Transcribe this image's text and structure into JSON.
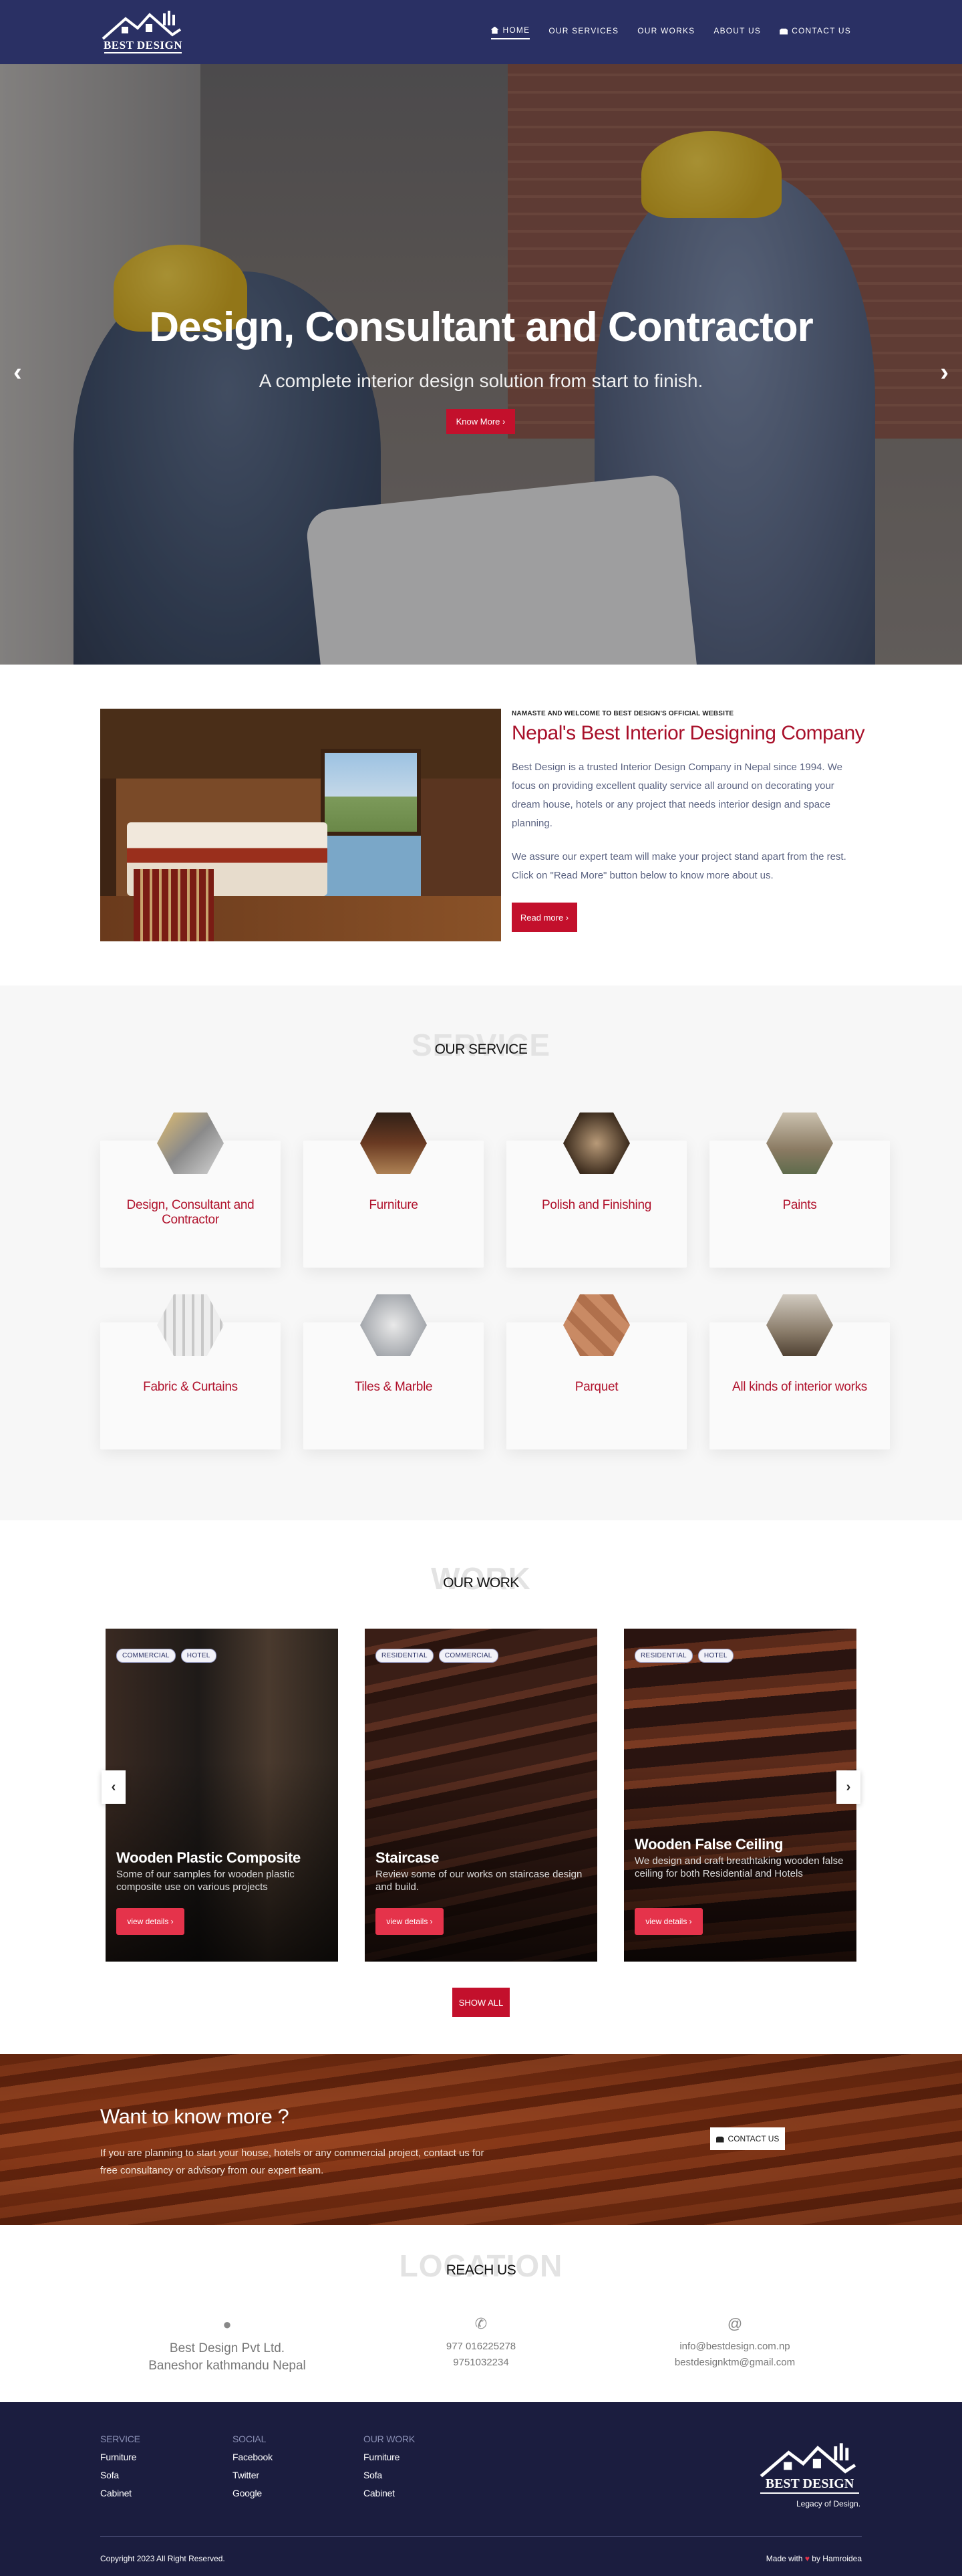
{
  "nav": {
    "logo": "BEST DESIGN",
    "items": [
      {
        "label": "HOME",
        "active": true,
        "icon": "home-icon"
      },
      {
        "label": "OUR SERVICES"
      },
      {
        "label": "OUR WORKS"
      },
      {
        "label": "ABOUT US"
      },
      {
        "label": "CONTACT US",
        "icon": "bag-icon"
      }
    ]
  },
  "hero": {
    "title": "Design, Consultant and Contractor",
    "subtitle": "A complete interior design solution from start to finish.",
    "button": "Know More ›",
    "prev": "‹",
    "next": "›"
  },
  "about": {
    "kicker": "NAMASTE AND WELCOME TO BEST DESIGN'S OFFICIAL WEBSITE",
    "title": "Nepal's Best Interior Designing Company",
    "p1": "Best Design is a trusted Interior Design Company in Nepal since 1994. We focus on providing excellent quality service all around on decorating your dream house, hotels or any project that needs interior design and space planning.",
    "p2": "We assure our expert team will make your project stand apart from the rest. Click on \"Read More\" button below to know more about us.",
    "button": "Read more ›"
  },
  "services": {
    "ghost": "SERVICE",
    "title": "OUR SERVICE",
    "items": [
      "Design, Consultant and Contractor",
      "Furniture",
      "Polish and Finishing",
      "Paints",
      "Fabric & Curtains",
      "Tiles & Marble",
      "Parquet",
      "All kinds of interior works"
    ]
  },
  "work": {
    "ghost": "WORK",
    "title": "OUR WORK",
    "show_all": "SHOW ALL",
    "prev": "‹",
    "next": "›",
    "items": [
      {
        "tags": [
          "COMMERCIAL",
          "HOTEL"
        ],
        "title": "Wooden Plastic Composite",
        "desc": "Some of our samples for wooden plastic composite use on various projects",
        "button": "view details ›"
      },
      {
        "tags": [
          "RESIDENTIAL",
          "COMMERCIAL"
        ],
        "title": "Staircase",
        "desc": "Review some of our works on staircase design and build.",
        "button": "view details ›"
      },
      {
        "tags": [
          "RESIDENTIAL",
          "HOTEL"
        ],
        "title": "Wooden False Ceiling",
        "desc": "We design and craft breathtaking wooden false ceiling for both Residential and Hotels",
        "button": "view details ›"
      }
    ]
  },
  "cta": {
    "title": "Want to know more ?",
    "text": "If you are planning to start your house, hotels or any commercial project, contact us for free consultancy or advisory from our expert team.",
    "button": "CONTACT US"
  },
  "location": {
    "ghost": "LOCATION",
    "title": "REACH US",
    "address": [
      "Best Design Pvt Ltd.",
      "Baneshor kathmandu Nepal"
    ],
    "phones": [
      "977 016225278",
      "9751032234"
    ],
    "emails": [
      "info@bestdesign.com.np",
      "bestdesignktm@gmail.com"
    ],
    "icons": {
      "map": "map-pin-icon",
      "phone": "phone-icon",
      "email": "at-icon"
    }
  },
  "footer": {
    "cols": [
      {
        "title": "SERVICE",
        "items": [
          "Furniture",
          "Sofa",
          "Cabinet"
        ]
      },
      {
        "title": "SOCIAL",
        "items": [
          "Facebook",
          "Twitter",
          "Google"
        ]
      },
      {
        "title": "OUR WORK",
        "items": [
          "Furniture",
          "Sofa",
          "Cabinet"
        ]
      }
    ],
    "logo": "BEST DESIGN",
    "legacy": "Legacy of Design.",
    "copyright": "Copyright 2023 All Right Reserved.",
    "made_with": "Made with",
    "by": "by Hamroidea"
  },
  "colors": {
    "navy": "#2a3064",
    "red": "#c3102c",
    "footer": "#1b1d3f"
  }
}
